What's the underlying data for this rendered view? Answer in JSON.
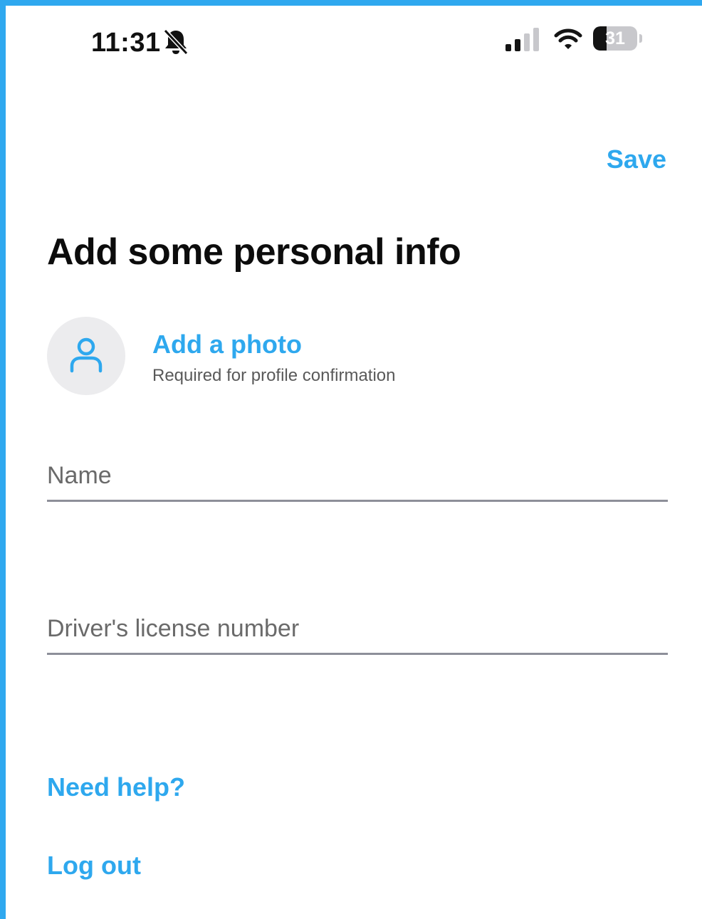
{
  "status_bar": {
    "time": "11:31",
    "battery_level": "31",
    "icons": [
      "bell-slash-icon",
      "cellular-signal-icon",
      "wifi-icon",
      "battery-icon"
    ]
  },
  "header": {
    "save_label": "Save"
  },
  "page": {
    "title": "Add some personal info"
  },
  "photo": {
    "add_label": "Add a photo",
    "subtitle": "Required for profile confirmation",
    "icon": "person-icon"
  },
  "form": {
    "name_placeholder": "Name",
    "license_placeholder": "Driver's license number",
    "name_value": "",
    "license_value": ""
  },
  "links": {
    "help": "Need help?",
    "logout": "Log out"
  },
  "colors": {
    "accent": "#2ea8ee",
    "frame": "#2fa8ef",
    "title": "#0c0c0c",
    "divider": "#8d8f99",
    "avatar_bg": "#ececee"
  }
}
